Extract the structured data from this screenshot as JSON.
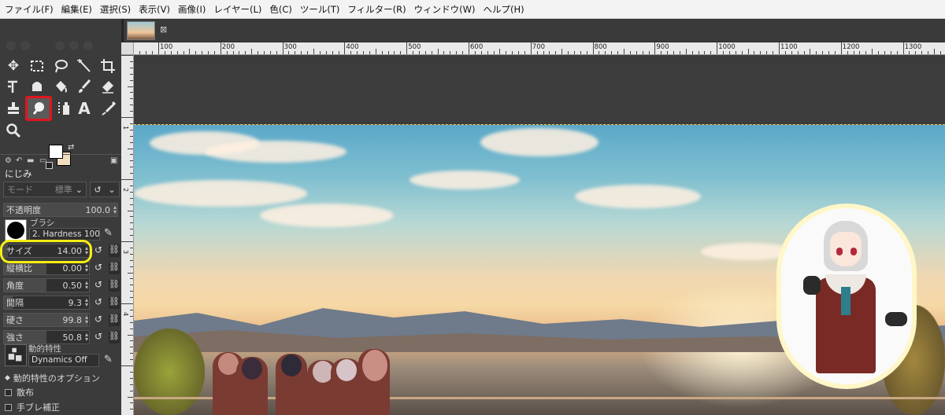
{
  "menu": [
    "ファイル(F)",
    "編集(E)",
    "選択(S)",
    "表示(V)",
    "画像(I)",
    "レイヤー(L)",
    "色(C)",
    "ツール(T)",
    "フィルター(R)",
    "ウィンドウ(W)",
    "ヘルプ(H)"
  ],
  "tool_options": {
    "title": "にじみ",
    "mode_label": "モード",
    "mode_value": "標準",
    "opacity": {
      "label": "不透明度",
      "value": "100.0"
    },
    "brush": {
      "label": "ブラシ",
      "name": "2. Hardness 100"
    },
    "size": {
      "label": "サイズ",
      "value": "14.00"
    },
    "aspect": {
      "label": "縦横比",
      "value": "0.00"
    },
    "angle": {
      "label": "角度",
      "value": "0.50"
    },
    "spacing": {
      "label": "間隔",
      "value": "9.3"
    },
    "hardness": {
      "label": "硬さ",
      "value": "99.8"
    },
    "force": {
      "label": "強さ",
      "value": "50.8"
    },
    "dynamics": {
      "label": "動的特性",
      "name": "Dynamics Off"
    },
    "dynamics_options": "動的特性のオプション",
    "scatter": "散布",
    "smooth": "手ブレ補正"
  },
  "ruler": {
    "labels": [
      "100",
      "200",
      "300",
      "400",
      "500",
      "600",
      "700",
      "800",
      "900",
      "1000",
      "1100",
      "1200",
      "1300"
    ],
    "vlabels": [
      "1",
      "2",
      "3",
      "4"
    ]
  },
  "image_tab": {
    "close": "⊠"
  },
  "colors": {
    "foreground": "#ffffff",
    "background": "#f2dcc0",
    "selected_tool_outline": "#e0161c",
    "size_highlight": "#f5ee14"
  },
  "selected_tool": "smudge-tool"
}
